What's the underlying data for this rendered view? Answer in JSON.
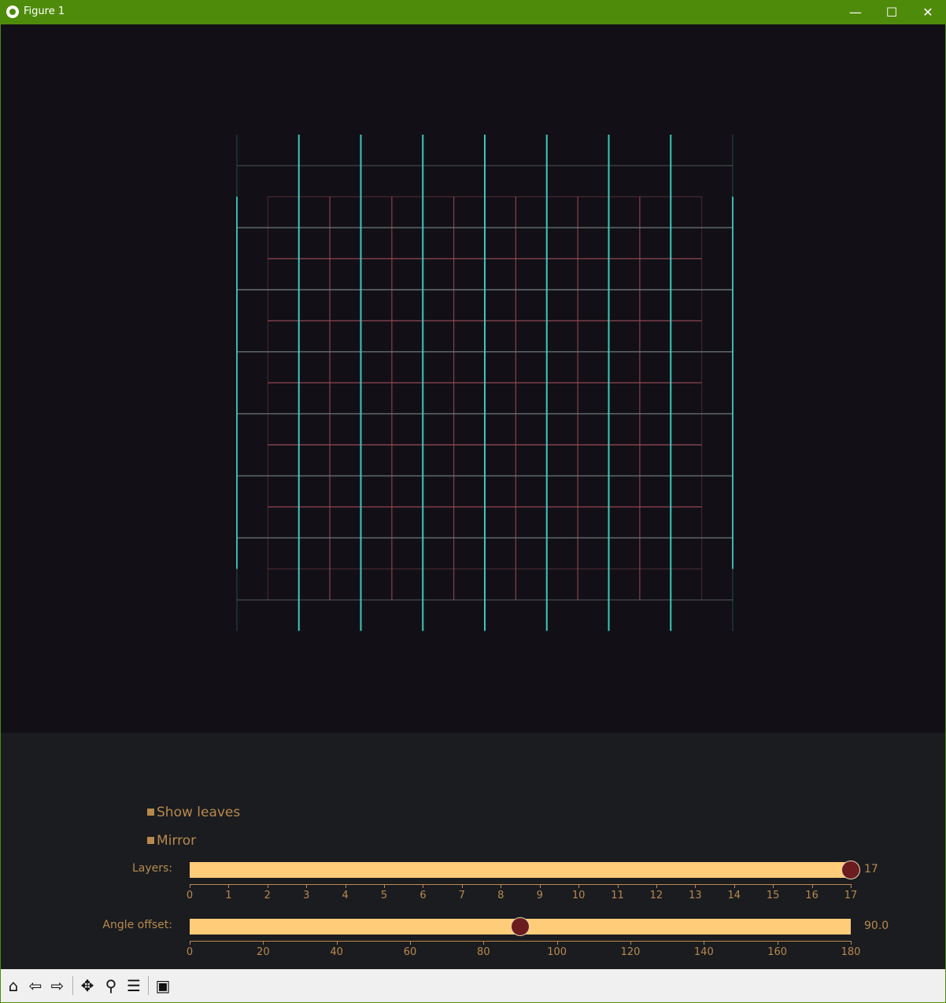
{
  "window": {
    "title": "Figure 1",
    "minimize_glyph": "—",
    "maximize_glyph": "☐",
    "close_glyph": "✕"
  },
  "colors": {
    "window_frame": "#4f8b0b",
    "canvas_background": "#121016",
    "controls_background": "#1a1c20",
    "vertical_lines": "#3fd1c6",
    "horizontal_lines_gray": "#6e7a7a",
    "inner_lines_red": "#9a4a55",
    "label_color": "#b8894d",
    "slider_track": "#ffcc7a",
    "slider_handle": "#6a1c1f"
  },
  "controls": {
    "show_leaves": {
      "label": "Show leaves"
    },
    "mirror": {
      "label": "Mirror"
    },
    "layers": {
      "label": "Layers:",
      "value_text": "17",
      "value": 17,
      "min": 0,
      "max": 17,
      "ticks": [
        "0",
        "1",
        "2",
        "3",
        "4",
        "5",
        "6",
        "7",
        "8",
        "9",
        "10",
        "11",
        "12",
        "13",
        "14",
        "15",
        "16",
        "17"
      ]
    },
    "angle_offset": {
      "label": "Angle offset:",
      "value_text": "90.0",
      "value": 90,
      "min": 0,
      "max": 180,
      "ticks": [
        "0",
        "20",
        "40",
        "60",
        "80",
        "100",
        "120",
        "140",
        "160",
        "180"
      ]
    }
  },
  "toolbar": {
    "home_icon": "⌂",
    "back_icon": "⇦",
    "forward_icon": "⇨",
    "pan_icon": "✥",
    "zoom_icon": "⚲",
    "configure_icon": "☰",
    "save_icon": "▣"
  }
}
